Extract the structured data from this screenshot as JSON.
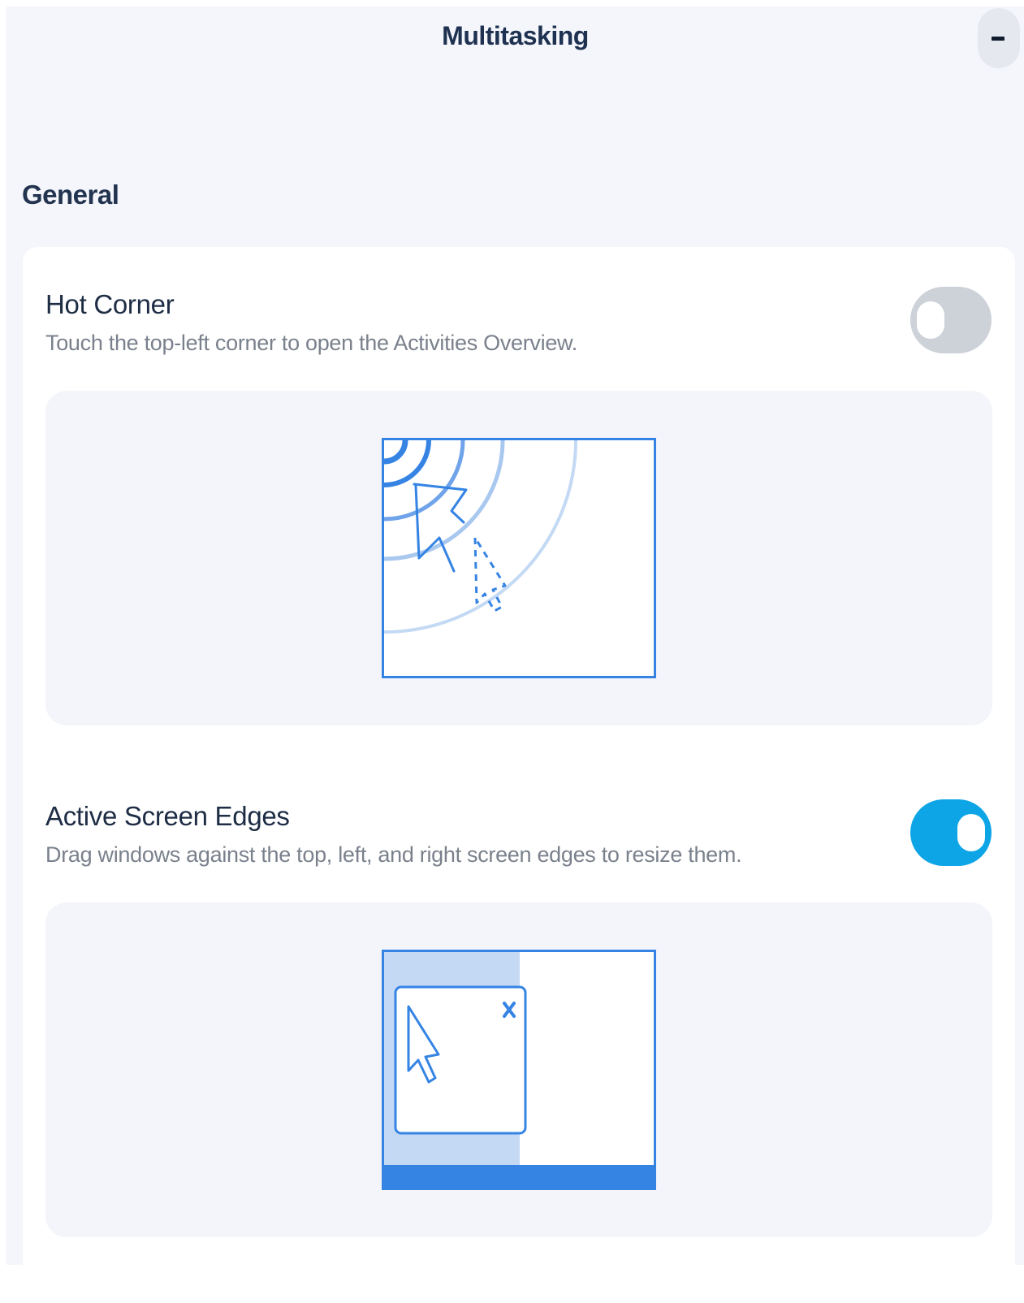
{
  "header": {
    "title": "Multitasking",
    "minimize_icon": "minimize-icon"
  },
  "general": {
    "section_title": "General",
    "hot_corner": {
      "title": "Hot Corner",
      "description": "Touch the top-left corner to open the Activities Overview.",
      "enabled": false,
      "illustration_icon": "hot-corner-illustration"
    },
    "active_screen_edges": {
      "title": "Active Screen Edges",
      "description": "Drag windows against the top, left, and right screen edges to resize them.",
      "enabled": true,
      "illustration_icon": "active-screen-edges-illustration"
    }
  },
  "colors": {
    "accent": "#0ea5e6",
    "illustration_blue": "#3584e4",
    "illustration_light_blue": "#c3d9f4",
    "title_text": "#1e2d45",
    "description_text": "#7a818c"
  }
}
